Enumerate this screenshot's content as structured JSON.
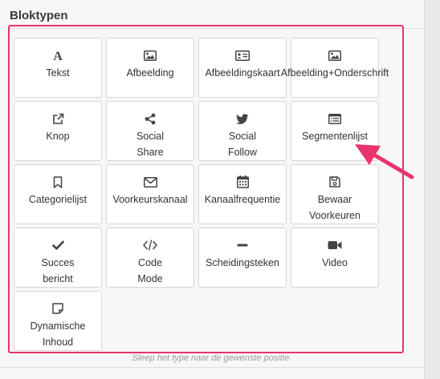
{
  "panel": {
    "title": "Bloktypen",
    "hint": "Sleep het type naar de gewenste positie."
  },
  "colors": {
    "highlight": "#e8336b",
    "icon": "#444444"
  },
  "tiles": [
    {
      "name": "tekst",
      "icon": "text-a-icon",
      "lines": [
        "Tekst"
      ]
    },
    {
      "name": "afbeelding",
      "icon": "image-icon",
      "lines": [
        "Afbeelding"
      ]
    },
    {
      "name": "afbeeldingskaart",
      "icon": "id-card-icon",
      "lines": [
        "Afbeeldingskaart"
      ]
    },
    {
      "name": "afbeelding-onderschrift",
      "icon": "image-caption-icon",
      "lines": [
        "Afbeelding+Onderschrift"
      ]
    },
    {
      "name": "knop",
      "icon": "external-link-icon",
      "lines": [
        "Knop"
      ]
    },
    {
      "name": "social-share",
      "icon": "share-icon",
      "lines": [
        "Social",
        "Share"
      ]
    },
    {
      "name": "social-follow",
      "icon": "twitter-icon",
      "lines": [
        "Social",
        "Follow"
      ]
    },
    {
      "name": "segmentenlijst",
      "icon": "list-icon",
      "lines": [
        "Segmentenlijst"
      ]
    },
    {
      "name": "categorielijst",
      "icon": "bookmark-icon",
      "lines": [
        "Categorielijst"
      ]
    },
    {
      "name": "voorkeurskanaal",
      "icon": "envelope-icon",
      "lines": [
        "Voorkeurskanaal"
      ]
    },
    {
      "name": "kanaalfrequentie",
      "icon": "calendar-icon",
      "lines": [
        "Kanaalfrequentie"
      ]
    },
    {
      "name": "bewaar-voorkeuren",
      "icon": "save-icon",
      "lines": [
        "Bewaar",
        "Voorkeuren"
      ]
    },
    {
      "name": "succes-bericht",
      "icon": "checkmark-icon",
      "lines": [
        "Succes",
        "bericht"
      ]
    },
    {
      "name": "code-mode",
      "icon": "code-icon",
      "lines": [
        "Code",
        "Mode"
      ]
    },
    {
      "name": "scheidingsteken",
      "icon": "minus-icon",
      "lines": [
        "Scheidingsteken"
      ]
    },
    {
      "name": "video",
      "icon": "video-camera-icon",
      "lines": [
        "Video"
      ]
    },
    {
      "name": "dynamische-inhoud",
      "icon": "sticky-note-icon",
      "lines": [
        "Dynamische",
        "Inhoud"
      ]
    }
  ]
}
